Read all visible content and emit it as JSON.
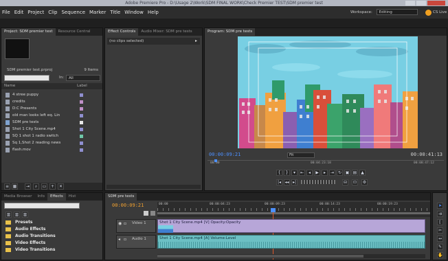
{
  "window": {
    "title": "Adobe Premiere Pro - D:\\Usage 2\\Work\\SDM FINAL WORK\\Check Premier TEST\\SDM premier test"
  },
  "menu": [
    "File",
    "Edit",
    "Project",
    "Clip",
    "Sequence",
    "Marker",
    "Title",
    "Window",
    "Help"
  ],
  "workspace": {
    "label": "Workspace:",
    "value": "Editing",
    "user": "CS Live"
  },
  "project": {
    "tabs": [
      "Project: SDM premier test",
      "Resource Central"
    ],
    "name": "SDM premier test.prproj",
    "count": "9 Items",
    "in_label": "In:",
    "in_value": "All",
    "columns": [
      "Name",
      "Label"
    ],
    "items": [
      {
        "name": "4 stree puppy",
        "color": "#8f8fd0"
      },
      {
        "name": "credits",
        "color": "#c090c8"
      },
      {
        "name": "D:C Presents",
        "color": "#c090c8"
      },
      {
        "name": "old man looks left eq. Lin",
        "color": "#8f8fd0"
      },
      {
        "name": "SDM pre tests",
        "color": "#e8e8e8"
      },
      {
        "name": "Shot 1 City Scene.mp4",
        "color": "#8f8fd0"
      },
      {
        "name": "SQ 1 shot 1 radio switch",
        "color": "#6fc7a8"
      },
      {
        "name": "Sq 1,Shot 2 reading news",
        "color": "#8f8fd0"
      },
      {
        "name": "flash.mov",
        "color": "#8f8fd0"
      }
    ]
  },
  "effect_controls": {
    "tabs": [
      "Effect Controls",
      "Audio Mixer: SDM pre tests"
    ],
    "message": "(no clips selected)"
  },
  "program": {
    "tabs": [
      "Program: SDM pre tests"
    ],
    "timecode_left": "00:00:09:21",
    "fit": "Fit",
    "timecode_right": "00:00:41:13",
    "ruler": [
      "00:00",
      "00:04:23:18",
      "00:08:47:12"
    ]
  },
  "effects": {
    "tabs": [
      "Media Browser",
      "Info",
      "Effects",
      "Hist"
    ],
    "items": [
      "Presets",
      "Audio Effects",
      "Audio Transitions",
      "Video Effects",
      "Video Transitions"
    ]
  },
  "timeline": {
    "tabs": [
      "SDM pre tests"
    ],
    "timecode": "00:00:09:21",
    "ruler": [
      "00:00",
      "00:00:04:23",
      "00:00:09:23",
      "00:00:14:23",
      "00:00:19:23"
    ],
    "video_track": "Video 1",
    "audio_track": "Audio 1",
    "video_clip": "Shot 1 City Scene.mp4 [V] Opacity:Opacity",
    "audio_clip": "Shot 1 City Scene.mp4 [A] Volume:Level"
  },
  "colors": {
    "accent_blue": "#4d90ff",
    "timecode_orange": "#f0a030",
    "playhead": "#e05a2a",
    "clip_audio": "#6cc0c4"
  }
}
